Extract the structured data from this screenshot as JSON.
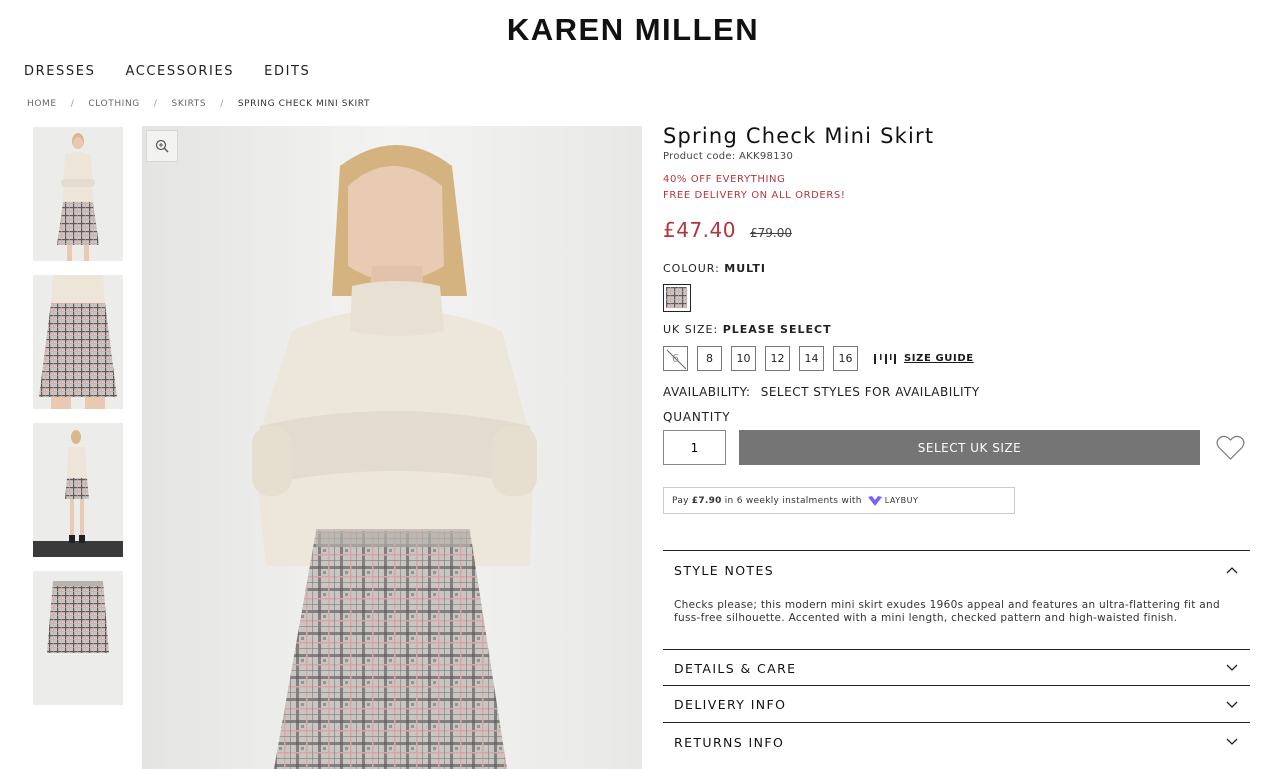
{
  "brand": "KAREN MILLEN",
  "nav": [
    "DRESSES",
    "ACCESSORIES",
    "EDITS"
  ],
  "breadcrumb": [
    "HOME",
    "CLOTHING",
    "SKIRTS",
    "SPRING CHECK MINI SKIRT"
  ],
  "product": {
    "title": "Spring Check Mini Skirt",
    "code": "Product code: AKK98130",
    "promo1": "40% OFF EVERYTHING",
    "promo2": "FREE DELIVERY ON ALL ORDERS!",
    "price_now": "£47.40",
    "price_was": "£79.00"
  },
  "colour": {
    "label": "COLOUR:",
    "value": "MULTI"
  },
  "size": {
    "label": "UK SIZE:",
    "value": "PLEASE SELECT",
    "options": [
      "6",
      "8",
      "10",
      "12",
      "14",
      "16"
    ],
    "guide": "SIZE GUIDE"
  },
  "availability": {
    "label": "AVAILABILITY:",
    "value": "SELECT STYLES FOR AVAILABILITY"
  },
  "quantity": {
    "label": "QUANTITY",
    "value": "1"
  },
  "add_button": "SELECT UK SIZE",
  "laybuy": {
    "pre": "Pay",
    "amount": "£7.90",
    "post": "in 6 weekly instalments with",
    "brand": "LAYBUY"
  },
  "accordion": {
    "style_notes": {
      "title": "STYLE NOTES",
      "body": "Checks please; this modern mini skirt exudes 1960s appeal and features an ultra-flattering fit and fuss-free silhouette. Accented with a mini length, checked pattern and high-waisted finish."
    },
    "details": "DETAILS & CARE",
    "delivery": "DELIVERY INFO",
    "returns": "RETURNS INFO"
  },
  "colors": {
    "sale": "#b5343c",
    "button": "#757575",
    "laybuy": "#7b61ff"
  }
}
